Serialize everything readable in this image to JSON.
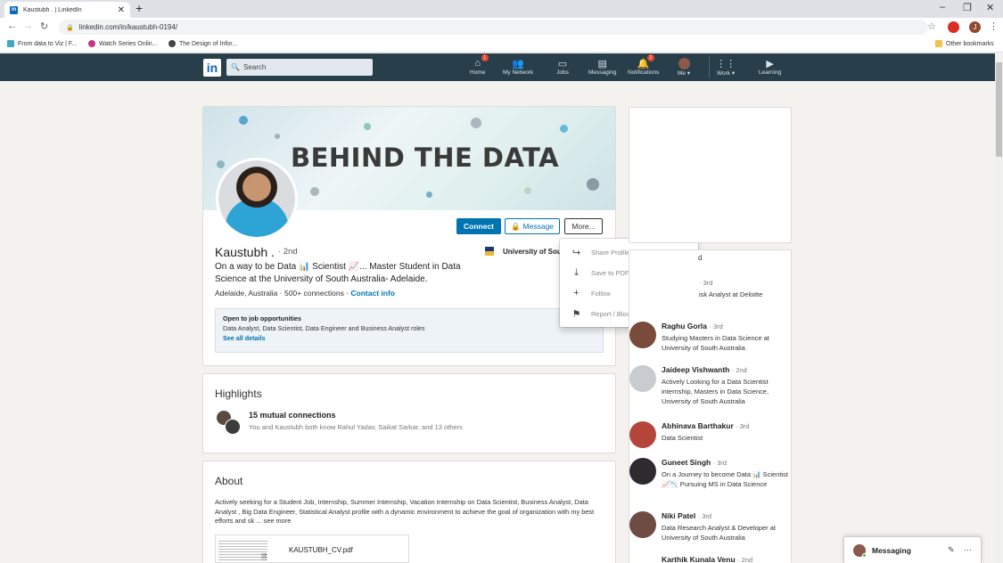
{
  "browser": {
    "tab_title": "Kaustubh . | LinkedIn",
    "tab_close": "✕",
    "new_tab": "+",
    "url": "linkedin.com/in/kaustubh-0194/",
    "bookmarks": [
      {
        "label": "From data to Viz | F..."
      },
      {
        "label": "Watch Series Onlin..."
      },
      {
        "label": "The Design of Infor..."
      }
    ],
    "other_bookmarks": "Other bookmarks",
    "profile_initial": "J"
  },
  "nav": {
    "search_placeholder": "Search",
    "items": [
      {
        "label": "Home",
        "badge": "1"
      },
      {
        "label": "My Network",
        "badge": ""
      },
      {
        "label": "Jobs",
        "badge": ""
      },
      {
        "label": "Messaging",
        "badge": ""
      },
      {
        "label": "Notifications",
        "badge": "2"
      },
      {
        "label": "Me ▾",
        "badge": ""
      },
      {
        "label": "Work ▾",
        "badge": ""
      },
      {
        "label": "Learning",
        "badge": ""
      }
    ]
  },
  "profile": {
    "banner_text": "BEHIND THE DATA",
    "connect_label": "Connect",
    "message_label": "Message",
    "more_label": "More...",
    "name": "Kaustubh .",
    "degree": "· 2nd",
    "headline": "On a way to be Data 📊 Scientist 📈... Master Student in Data Science at the University of South Australia- Adelaide.",
    "location": "Adelaide, Australia · 500+ connections ·",
    "contact_info": "Contact info",
    "education": "University of Sou",
    "job_title": "Open to job opportunities",
    "job_roles": "Data Analyst, Data Scientist, Data Engineer and Business Analyst roles",
    "job_link": "See all details"
  },
  "dropdown": {
    "items": [
      {
        "label": "Share Profile via Message",
        "icon": "share-icon"
      },
      {
        "label": "Save to PDF",
        "icon": "download-icon"
      },
      {
        "label": "Follow",
        "icon": "plus-icon"
      },
      {
        "label": "Report / Block",
        "icon": "flag-icon"
      }
    ]
  },
  "highlights": {
    "title": "Highlights",
    "mutual_title": "15 mutual connections",
    "mutual_sub": "You and Kaustubh both know Rahul Yadav, Saikat Sarkar, and 13 others"
  },
  "about": {
    "title": "About",
    "text": "Actively seeking for a Student Job, Internship, Summer Internship, Vacation Internship on Data Scientist, Business Analyst, Data Analyst , Big Data Engineer, Statistical Analyst profile with a dynamic environment to achieve the goal of organization with my best efforts and sk",
    "see_more": "... see more",
    "cv_name": "KAUSTUBH_CV.pdf"
  },
  "right_rail": {
    "pav_fragment": "d",
    "people": [
      {
        "name": "",
        "degree": "· 3rd",
        "desc": "isk Analyst at Deloitte"
      },
      {
        "name": "Raghu Gorla",
        "degree": "· 3rd",
        "desc": "Studying Masters in Data Science at University of South Australia"
      },
      {
        "name": "Jaideep Vishwanth",
        "degree": "· 2nd",
        "desc": "Actively Looking for a Data Scientist internship, Masters in Data Science, University of South Australia"
      },
      {
        "name": "Abhinava Barthakur",
        "degree": "· 3rd",
        "desc": "Data Scientist"
      },
      {
        "name": "Guneet Singh",
        "degree": "· 3rd",
        "desc": "On a Journey to become Data 📊 Scientist 📈📉 Pursuing MS in Data Science"
      },
      {
        "name": "Niki Patel",
        "degree": "· 3rd",
        "desc": "Data Research Analyst & Developer at University of South Australia"
      },
      {
        "name": "Karthik Kunala Venu",
        "degree": "· 2nd",
        "desc": ""
      }
    ]
  },
  "messaging": {
    "label": "Messaging"
  }
}
